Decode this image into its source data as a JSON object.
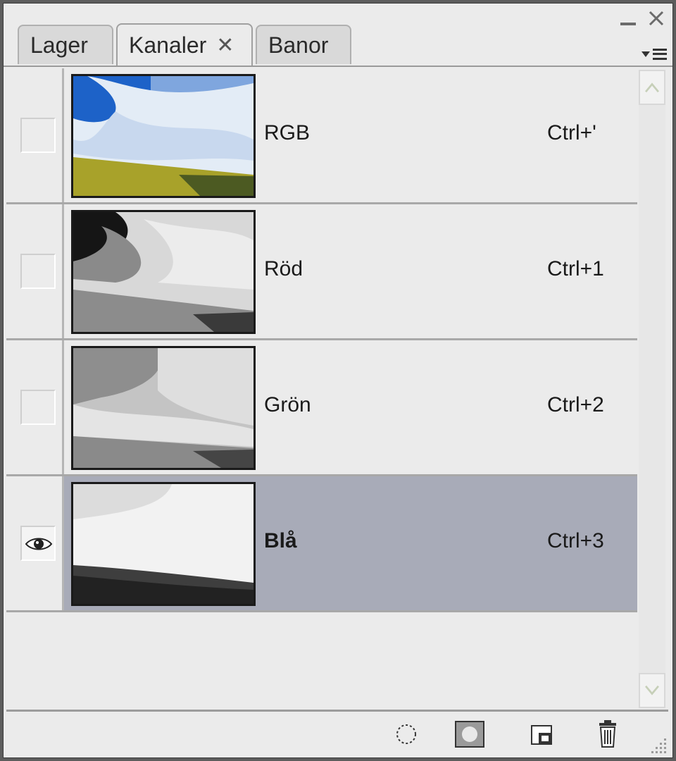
{
  "tabs": [
    {
      "label": "Lager",
      "active": false
    },
    {
      "label": "Kanaler",
      "active": true,
      "close_glyph": "✕"
    },
    {
      "label": "Banor",
      "active": false
    }
  ],
  "window_controls": {
    "minimize_icon": "minus-icon",
    "close_icon": "close-icon"
  },
  "panel_menu_icon": "panel-menu-icon",
  "channels": [
    {
      "name": "RGB",
      "shortcut": "Ctrl+'",
      "visible": false,
      "selected": false,
      "thumb": "rgb"
    },
    {
      "name": "Röd",
      "shortcut": "Ctrl+1",
      "visible": false,
      "selected": false,
      "thumb": "red"
    },
    {
      "name": "Grön",
      "shortcut": "Ctrl+2",
      "visible": false,
      "selected": false,
      "thumb": "green"
    },
    {
      "name": "Blå",
      "shortcut": "Ctrl+3",
      "visible": true,
      "selected": true,
      "thumb": "blue"
    }
  ],
  "bottom_tools": [
    {
      "icon": "load-selection-icon"
    },
    {
      "icon": "save-selection-icon"
    },
    {
      "icon": "new-channel-icon"
    },
    {
      "icon": "trash-icon"
    }
  ],
  "colors": {
    "selected_row": "#a8abb8",
    "panel_bg": "#ebebeb"
  }
}
